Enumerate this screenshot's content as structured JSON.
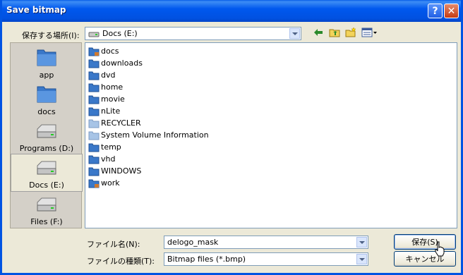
{
  "window": {
    "title": "Save bitmap"
  },
  "titlebar": {
    "help_glyph": "?",
    "close_glyph": "✕"
  },
  "lookin": {
    "label": "保存する場所(I):",
    "value": "Docs (E:)"
  },
  "toolbar": {
    "back_icon": "back-arrow-icon",
    "up_icon": "up-folder-icon",
    "new_folder_icon": "new-folder-icon",
    "view_icon": "view-menu-icon"
  },
  "places": [
    {
      "label": "app",
      "icon": "folder-icon"
    },
    {
      "label": "docs",
      "icon": "folder-icon"
    },
    {
      "label": "Programs (D:)",
      "icon": "drive-icon"
    },
    {
      "label": "Docs (E:)",
      "icon": "drive-icon",
      "selected": true
    },
    {
      "label": "Files (F:)",
      "icon": "drive-icon"
    }
  ],
  "files": [
    {
      "name": "docs",
      "icon": "folder-special-icon"
    },
    {
      "name": "downloads",
      "icon": "folder-icon"
    },
    {
      "name": "dvd",
      "icon": "folder-icon"
    },
    {
      "name": "home",
      "icon": "folder-icon"
    },
    {
      "name": "movie",
      "icon": "folder-icon"
    },
    {
      "name": "nLite",
      "icon": "folder-icon"
    },
    {
      "name": "RECYCLER",
      "icon": "folder-hidden-icon"
    },
    {
      "name": "System Volume Information",
      "icon": "folder-hidden-icon"
    },
    {
      "name": "temp",
      "icon": "folder-icon"
    },
    {
      "name": "vhd",
      "icon": "folder-icon"
    },
    {
      "name": "WINDOWS",
      "icon": "folder-icon"
    },
    {
      "name": "work",
      "icon": "folder-special-icon"
    }
  ],
  "filename": {
    "label": "ファイル名(N):",
    "value": "delogo_mask"
  },
  "filetype": {
    "label": "ファイルの種類(T):",
    "value": "Bitmap files (*.bmp)"
  },
  "buttons": {
    "save": "保存(S)",
    "cancel": "キャンセル"
  },
  "colors": {
    "titlebar": "#0058ee",
    "face": "#ece9d8",
    "folder": "#3a78c9"
  }
}
